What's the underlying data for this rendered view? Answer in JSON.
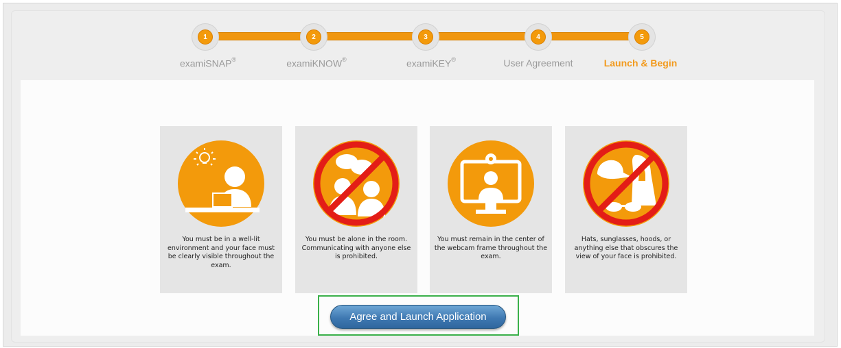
{
  "colors": {
    "accent": "#f39a0b",
    "prohibit": "#e31d17",
    "button": "#3f79b2",
    "highlight": "#3ab04a"
  },
  "steps": [
    {
      "number": "1",
      "label": "examiSNAP",
      "mark": "®"
    },
    {
      "number": "2",
      "label": "examiKNOW",
      "mark": "®"
    },
    {
      "number": "3",
      "label": "examiKEY",
      "mark": "®"
    },
    {
      "number": "4",
      "label": "User Agreement",
      "mark": ""
    },
    {
      "number": "5",
      "label": "Launch & Begin",
      "mark": ""
    }
  ],
  "rules": [
    {
      "icon": "well-lit-face-icon",
      "text": "You must be in a well-lit environment and your face must be clearly visible throughout the exam."
    },
    {
      "icon": "no-people-icon",
      "text": "You must be alone in the room. Communicating with anyone else is prohibited."
    },
    {
      "icon": "webcam-center-icon",
      "text": "You must remain in the center of the webcam frame throughout the exam."
    },
    {
      "icon": "no-hats-sunglasses-icon",
      "text": "Hats, sunglasses, hoods, or anything else that obscures the view of your face is prohibited."
    }
  ],
  "launch_button": "Agree and Launch Application"
}
